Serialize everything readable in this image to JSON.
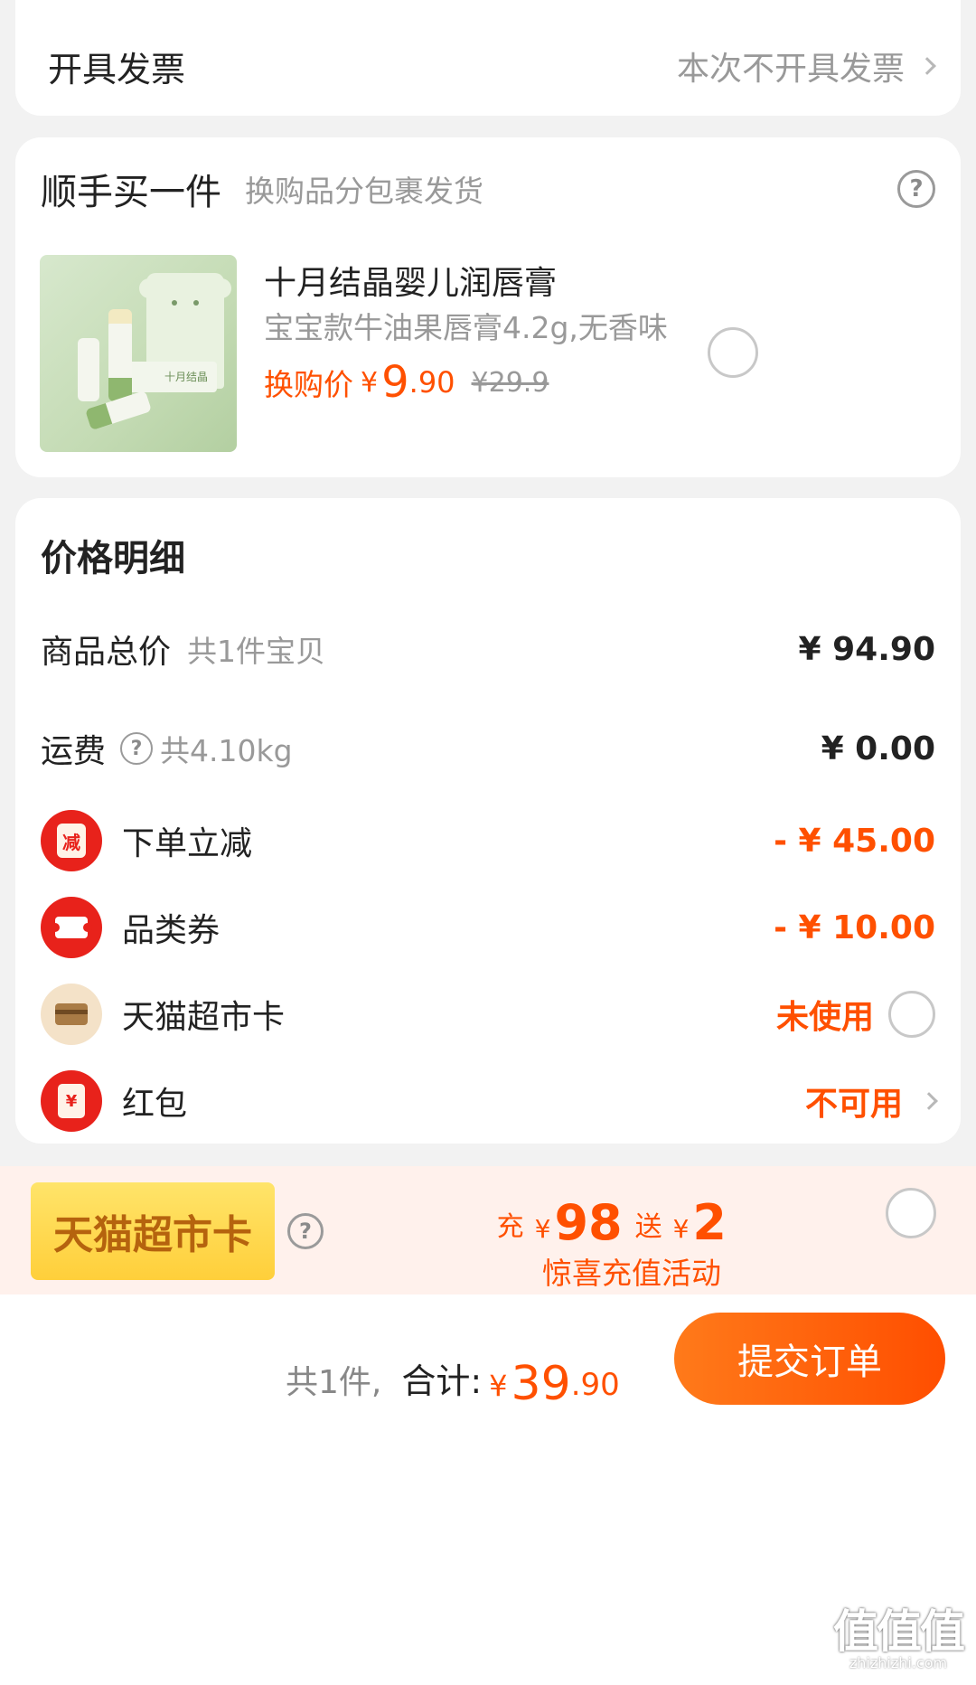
{
  "invoice": {
    "label": "开具发票",
    "value": "本次不开具发票"
  },
  "addon": {
    "title": "顺手买一件",
    "subtitle": "换购品分包裹发货",
    "product": {
      "name": "十月结晶婴儿润唇膏",
      "spec": "宝宝款牛油果唇膏4.2g,无香味",
      "price_label": "换购价",
      "currency": "¥",
      "price_int": "9",
      "price_dec": ".90",
      "original_price": "¥29.9",
      "image_text": "十月结晶"
    }
  },
  "price_detail": {
    "title": "价格明细",
    "total": {
      "label": "商品总价",
      "note": "共1件宝贝",
      "value": "¥ 94.90"
    },
    "shipping": {
      "label": "运费",
      "note": "共4.10kg",
      "value": "¥ 0.00"
    },
    "discount": {
      "label": "下单立减",
      "value": "- ¥ 45.00",
      "icon_text": "减"
    },
    "coupon": {
      "label": "品类券",
      "value": "- ¥ 10.00"
    },
    "supermarket_card": {
      "label": "天猫超市卡",
      "value": "未使用"
    },
    "red_packet": {
      "label": "红包",
      "value": "不可用",
      "icon_text": "¥"
    }
  },
  "promo": {
    "badge": "天猫超市卡",
    "charge_prefix": "充",
    "charge_currency": "¥",
    "charge_amount": "98",
    "gift_prefix": "送",
    "gift_currency": "¥",
    "gift_amount": "2",
    "activity": "惊喜充值活动"
  },
  "footer": {
    "count": "共1件,",
    "total_label": "合计:",
    "currency": "¥",
    "total_int": "39",
    "total_dec": ".90",
    "submit": "提交订单"
  },
  "watermark": {
    "text": "值值值",
    "url": "zhizhizhi.com"
  },
  "colors": {
    "accent": "#ff5000",
    "red": "#e8221b",
    "promo_bg": "#fff1ec",
    "badge": "#ffd84a"
  }
}
